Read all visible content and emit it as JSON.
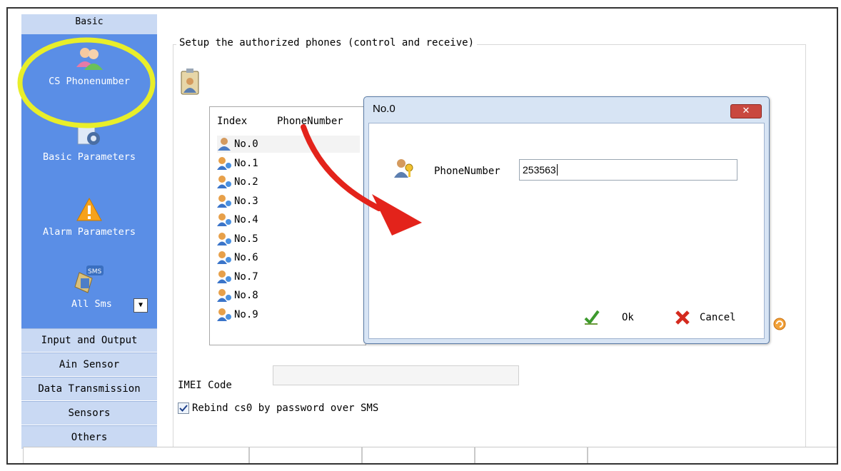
{
  "sidebar": {
    "top_section": "Basic",
    "items": [
      {
        "label": "CS Phonenumber",
        "icon": "users-icon"
      },
      {
        "label": "Basic Parameters",
        "icon": "settings-gear-icon"
      },
      {
        "label": "Alarm Parameters",
        "icon": "warning-icon"
      },
      {
        "label": "All Sms",
        "icon": "sms-icon"
      }
    ],
    "sections": [
      "Input and Output",
      "Ain Sensor",
      "Data Transmission",
      "Sensors",
      "Others"
    ]
  },
  "main": {
    "group_title": "Setup the authorized phones (control and receive)",
    "list": {
      "columns": [
        "Index",
        "PhoneNumber"
      ],
      "rows": [
        "No.0",
        "No.1",
        "No.2",
        "No.3",
        "No.4",
        "No.5",
        "No.6",
        "No.7",
        "No.8",
        "No.9"
      ]
    },
    "imei_label": "IMEI Code",
    "imei_value": "",
    "rebind_label": "Rebind cs0 by password over SMS",
    "rebind_checked": true
  },
  "dialog": {
    "title": "No.0",
    "close": "✕",
    "field_label": "PhoneNumber",
    "field_value": "253563",
    "ok_label": "Ok",
    "cancel_label": "Cancel"
  },
  "colors": {
    "sidebar_panel": "#5a8ee6",
    "highlight_circle": "#e8ee2a",
    "arrow": "#e3231b"
  }
}
